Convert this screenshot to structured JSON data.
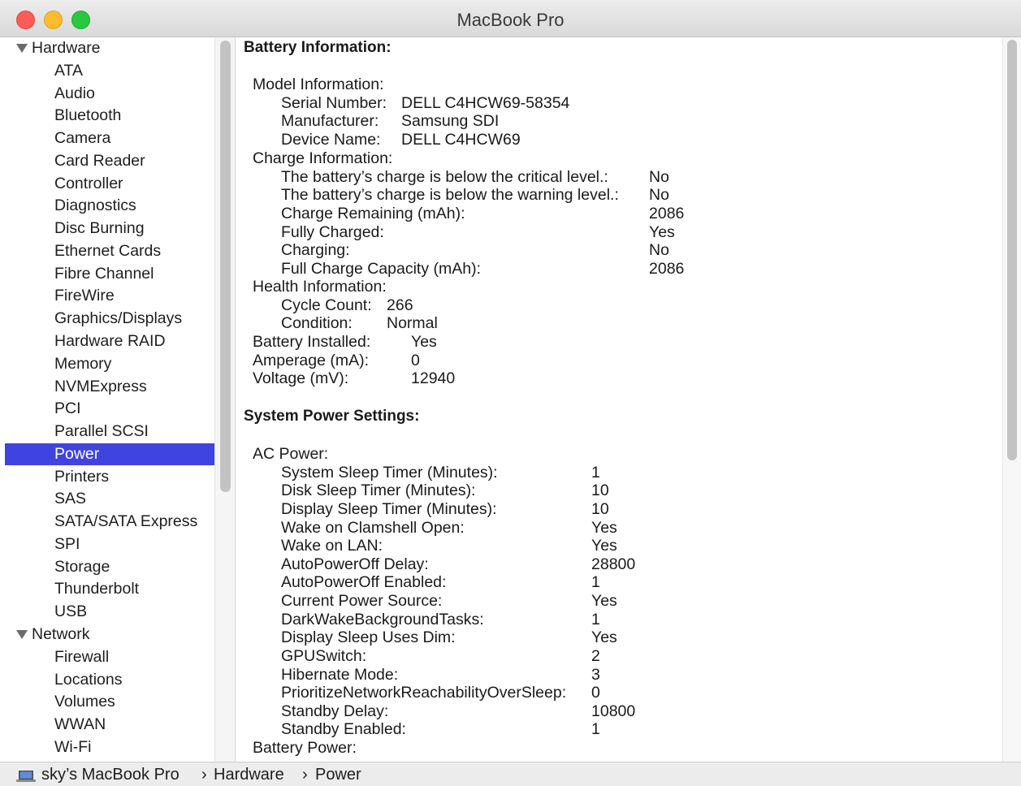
{
  "window": {
    "title": "MacBook Pro"
  },
  "sidebar": {
    "hardware_label": "Hardware",
    "hardware_items": [
      "ATA",
      "Audio",
      "Bluetooth",
      "Camera",
      "Card Reader",
      "Controller",
      "Diagnostics",
      "Disc Burning",
      "Ethernet Cards",
      "Fibre Channel",
      "FireWire",
      "Graphics/Displays",
      "Hardware RAID",
      "Memory",
      "NVMExpress",
      "PCI",
      "Parallel SCSI",
      "Power",
      "Printers",
      "SAS",
      "SATA/SATA Express",
      "SPI",
      "Storage",
      "Thunderbolt",
      "USB"
    ],
    "network_label": "Network",
    "network_items": [
      "Firewall",
      "Locations",
      "Volumes",
      "WWAN",
      "Wi-Fi"
    ],
    "selected": "Power"
  },
  "content": {
    "battery_heading": "Battery Information:",
    "model_info_label": "Model Information:",
    "model_info": [
      {
        "label": "Serial Number:",
        "value": "DELL C4HCW69-58354"
      },
      {
        "label": "Manufacturer:",
        "value": "Samsung SDI"
      },
      {
        "label": "Device Name:",
        "value": "DELL C4HCW69"
      }
    ],
    "charge_info_label": "Charge Information:",
    "charge_info": [
      {
        "label": "The battery’s charge is below the critical level.:",
        "value": "No"
      },
      {
        "label": "The battery’s charge is below the warning level.:",
        "value": "No"
      },
      {
        "label": "Charge Remaining (mAh):",
        "value": "2086"
      },
      {
        "label": "Fully Charged:",
        "value": "Yes"
      },
      {
        "label": "Charging:",
        "value": "No"
      },
      {
        "label": "Full Charge Capacity (mAh):",
        "value": "2086"
      }
    ],
    "health_info_label": "Health Information:",
    "health_info": [
      {
        "label": "Cycle Count:",
        "value": "266"
      },
      {
        "label": "Condition:",
        "value": "Normal"
      }
    ],
    "battery_top": [
      {
        "label": "Battery Installed:",
        "value": "Yes"
      },
      {
        "label": "Amperage (mA):",
        "value": "0"
      },
      {
        "label": "Voltage (mV):",
        "value": "12940"
      }
    ],
    "power_heading": "System Power Settings:",
    "ac_power_label": "AC Power:",
    "ac_power": [
      {
        "label": "System Sleep Timer (Minutes):",
        "value": "1"
      },
      {
        "label": "Disk Sleep Timer (Minutes):",
        "value": "10"
      },
      {
        "label": "Display Sleep Timer (Minutes):",
        "value": "10"
      },
      {
        "label": "Wake on Clamshell Open:",
        "value": "Yes"
      },
      {
        "label": "Wake on LAN:",
        "value": "Yes"
      },
      {
        "label": "AutoPowerOff Delay:",
        "value": "28800"
      },
      {
        "label": "AutoPowerOff Enabled:",
        "value": "1"
      },
      {
        "label": "Current Power Source:",
        "value": "Yes"
      },
      {
        "label": "DarkWakeBackgroundTasks:",
        "value": "1"
      },
      {
        "label": "Display Sleep Uses Dim:",
        "value": "Yes"
      },
      {
        "label": "GPUSwitch:",
        "value": "2"
      },
      {
        "label": "Hibernate Mode:",
        "value": "3"
      },
      {
        "label": "PrioritizeNetworkReachabilityOverSleep:",
        "value": "0"
      },
      {
        "label": "Standby Delay:",
        "value": "10800"
      },
      {
        "label": "Standby Enabled:",
        "value": "1"
      }
    ],
    "battery_power_label": "Battery Power:"
  },
  "statusbar": {
    "computer": "sky’s MacBook Pro",
    "separator": "›",
    "crumb_hardware": "Hardware",
    "crumb_power": "Power"
  }
}
